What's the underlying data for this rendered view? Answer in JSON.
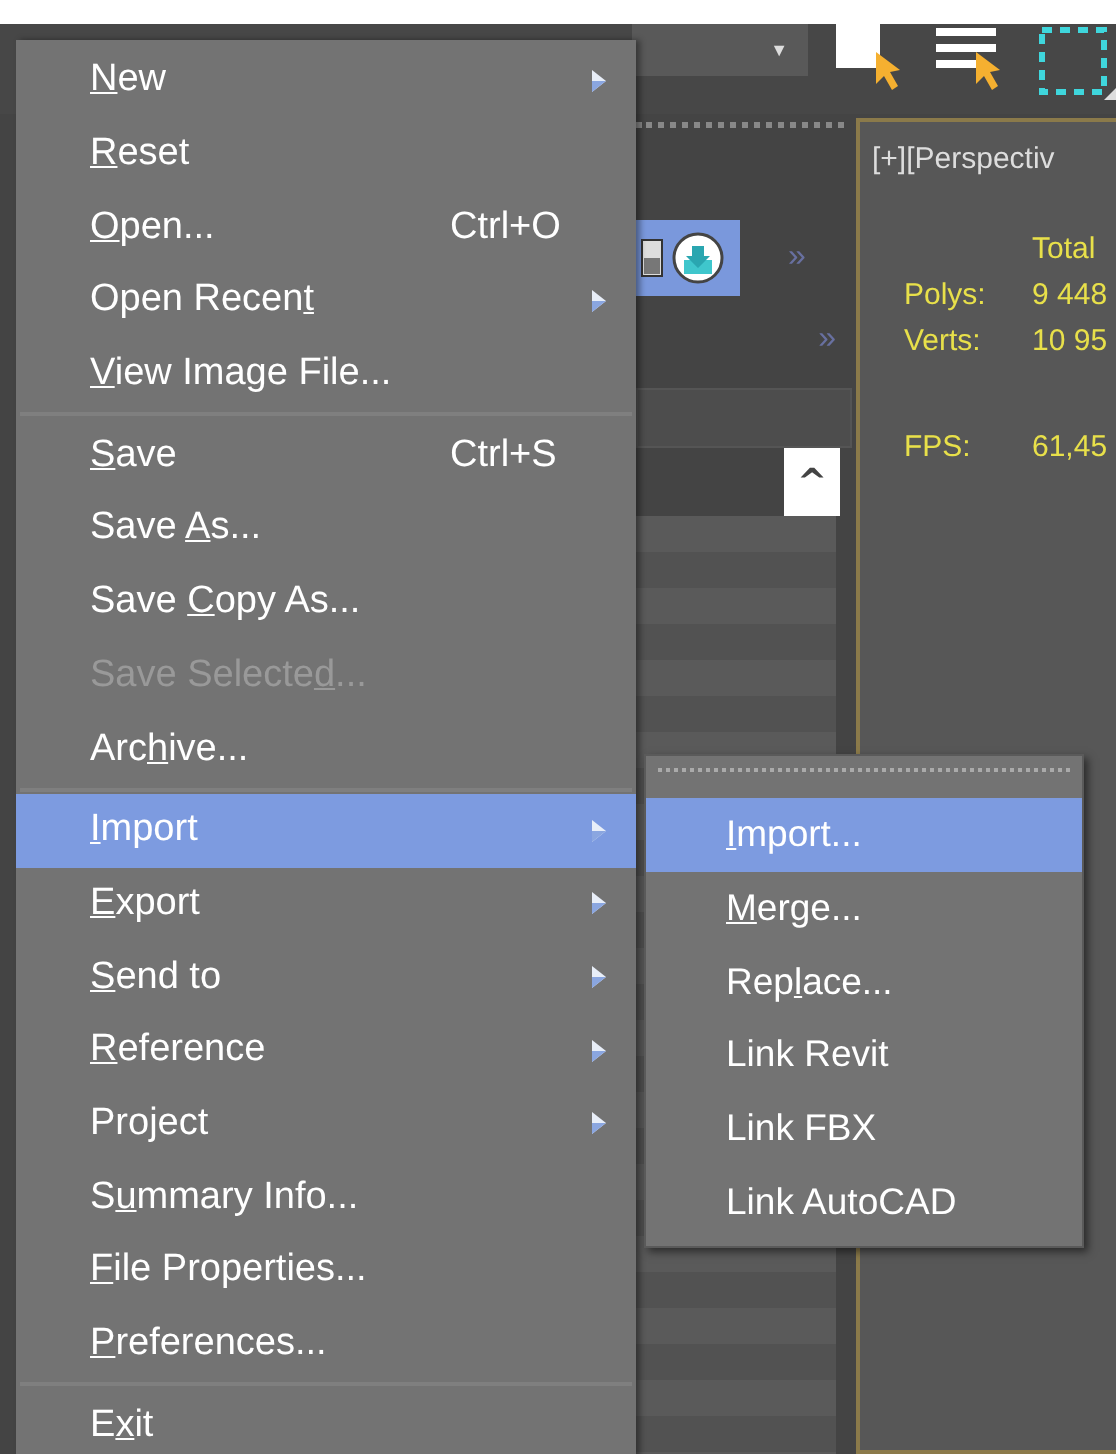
{
  "toolbar": {
    "dropdown": {
      "caret": "▼"
    }
  },
  "panel": {
    "expand_marks": [
      "»",
      "»"
    ],
    "scroll_up": "^"
  },
  "viewport": {
    "label": "[+][Perspectiv",
    "stats_header": "Total",
    "stats": [
      {
        "label": "Polys:",
        "value": "9 448"
      },
      {
        "label": "Verts:",
        "value": "10 95"
      }
    ],
    "fps": {
      "label": "FPS:",
      "value": "61,45"
    }
  },
  "file_menu": [
    {
      "kind": "item",
      "text": {
        "key": "N",
        "post": "ew"
      },
      "submenu": true,
      "selected": false,
      "disabled": false
    },
    {
      "kind": "item",
      "text": {
        "key": "R",
        "post": "eset"
      },
      "submenu": false,
      "selected": false,
      "disabled": false
    },
    {
      "kind": "item",
      "text": {
        "key": "O",
        "post": "pen..."
      },
      "shortcut": "Ctrl+O",
      "submenu": false,
      "selected": false,
      "disabled": false
    },
    {
      "kind": "item",
      "text": {
        "pre": "Open Recen",
        "key": "t"
      },
      "submenu": true,
      "selected": false,
      "disabled": false
    },
    {
      "kind": "item",
      "text": {
        "key": "V",
        "post": "iew Image File..."
      },
      "submenu": false,
      "selected": false,
      "disabled": false
    },
    {
      "kind": "separator"
    },
    {
      "kind": "item",
      "text": {
        "key": "S",
        "post": "ave"
      },
      "shortcut": "Ctrl+S",
      "submenu": false,
      "selected": false,
      "disabled": false
    },
    {
      "kind": "item",
      "text": {
        "pre": "Save ",
        "key": "A",
        "post": "s..."
      },
      "submenu": false,
      "selected": false,
      "disabled": false
    },
    {
      "kind": "item",
      "text": {
        "pre": "Save ",
        "key": "C",
        "post": "opy As..."
      },
      "submenu": false,
      "selected": false,
      "disabled": false
    },
    {
      "kind": "item",
      "text": {
        "pre": "Save Selecte",
        "key": "d",
        "post": "..."
      },
      "submenu": false,
      "selected": false,
      "disabled": true
    },
    {
      "kind": "item",
      "text": {
        "pre": "Arc",
        "key": "h",
        "post": "ive..."
      },
      "submenu": false,
      "selected": false,
      "disabled": false
    },
    {
      "kind": "separator"
    },
    {
      "kind": "item",
      "text": {
        "key": "I",
        "post": "mport"
      },
      "submenu": true,
      "selected": true,
      "disabled": false
    },
    {
      "kind": "item",
      "text": {
        "key": "E",
        "post": "xport"
      },
      "submenu": true,
      "selected": false,
      "disabled": false
    },
    {
      "kind": "item",
      "text": {
        "key": "S",
        "post": "end to"
      },
      "submenu": true,
      "selected": false,
      "disabled": false
    },
    {
      "kind": "item",
      "text": {
        "key": "R",
        "post": "eference"
      },
      "submenu": true,
      "selected": false,
      "disabled": false
    },
    {
      "kind": "item",
      "text": {
        "pre": "Project"
      },
      "submenu": true,
      "selected": false,
      "disabled": false
    },
    {
      "kind": "item",
      "text": {
        "pre": "S",
        "key": "u",
        "post": "mmary Info..."
      },
      "submenu": false,
      "selected": false,
      "disabled": false
    },
    {
      "kind": "item",
      "text": {
        "key": "F",
        "post": "ile Properties..."
      },
      "submenu": false,
      "selected": false,
      "disabled": false
    },
    {
      "kind": "item",
      "text": {
        "key": "P",
        "post": "references..."
      },
      "submenu": false,
      "selected": false,
      "disabled": false
    },
    {
      "kind": "separator"
    },
    {
      "kind": "item",
      "text": {
        "pre": "E",
        "key": "x",
        "post": "it"
      },
      "submenu": false,
      "selected": false,
      "disabled": false
    }
  ],
  "import_submenu": [
    {
      "text": {
        "key": "I",
        "post": "mport..."
      },
      "selected": true
    },
    {
      "text": {
        "key": "M",
        "post": "erge..."
      },
      "selected": false
    },
    {
      "text": {
        "pre": "Rep",
        "key": "l",
        "post": "ace..."
      },
      "selected": false
    },
    {
      "text": {
        "pre": "Link Revit"
      },
      "selected": false
    },
    {
      "text": {
        "pre": "Link FBX"
      },
      "selected": false
    },
    {
      "text": {
        "pre": "Link AutoCAD"
      },
      "selected": false
    }
  ]
}
